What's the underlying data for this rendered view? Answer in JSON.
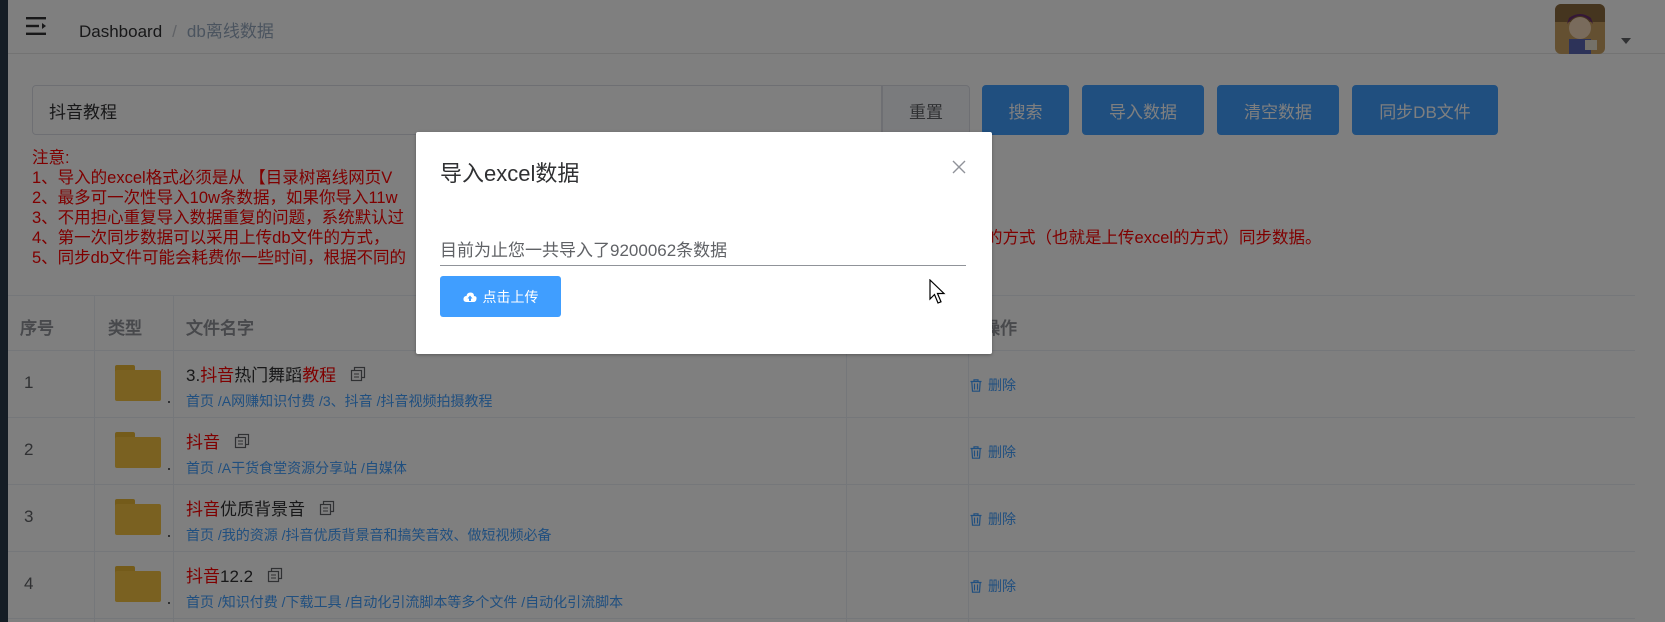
{
  "breadcrumb": {
    "home": "Dashboard",
    "separator": "/",
    "current": "db离线数据"
  },
  "search": {
    "value": "抖音教程"
  },
  "toolbar": {
    "reset_label": "重置",
    "search_label": "搜索",
    "import_label": "导入数据",
    "clear_label": "清空数据",
    "sync_label": "同步DB文件"
  },
  "notes": {
    "title": "注意:",
    "lines": [
      "1、导入的excel格式必须是从 【目录树离线网页V",
      "2、最多可一次性导入10w条数据，如果你导入11w",
      "3、不用担心重复导入数据重复的问题，系统默认过",
      "4、第一次同步数据可以采用上传db文件的方式，",
      "5、同步db文件可能会耗费你一些时间，根据不同的"
    ],
    "line4_tail": "，可以采用增量的方式（也就是上传excel的方式）同步数据。"
  },
  "table": {
    "headers": {
      "index": "序号",
      "type": "类型",
      "filename": "文件名字",
      "actions": "操作"
    },
    "rows": [
      {
        "index": "1",
        "name_parts": [
          [
            "3.",
            "n"
          ],
          [
            "抖音",
            "h"
          ],
          [
            "热门舞蹈",
            "n"
          ],
          [
            "教程",
            "h"
          ]
        ],
        "path": "首页 /A网赚知识付费 /3、抖音 /抖音视频拍摄教程",
        "delete_label": "删除"
      },
      {
        "index": "2",
        "name_parts": [
          [
            "抖音",
            "h"
          ]
        ],
        "path": "首页 /A干货食堂资源分享站 /自媒体",
        "delete_label": "删除"
      },
      {
        "index": "3",
        "name_parts": [
          [
            "抖音",
            "h"
          ],
          [
            "优质背景音",
            "n"
          ]
        ],
        "path": "首页 /我的资源 /抖音优质背景音和搞笑音效、做短视频必备",
        "delete_label": "删除"
      },
      {
        "index": "4",
        "name_parts": [
          [
            "抖音",
            "h"
          ],
          [
            "12.2",
            "n"
          ]
        ],
        "path": "首页 /知识付费 /下载工具 /自动化引流脚本等多个文件 /自动化引流脚本",
        "delete_label": "删除"
      }
    ]
  },
  "dialog": {
    "title": "导入excel数据",
    "message": "目前为止您一共导入了9200062条数据",
    "upload_label": "点击上传"
  },
  "colors": {
    "primary": "#409eff",
    "highlight": "#f00",
    "folder": "#f5c242"
  }
}
